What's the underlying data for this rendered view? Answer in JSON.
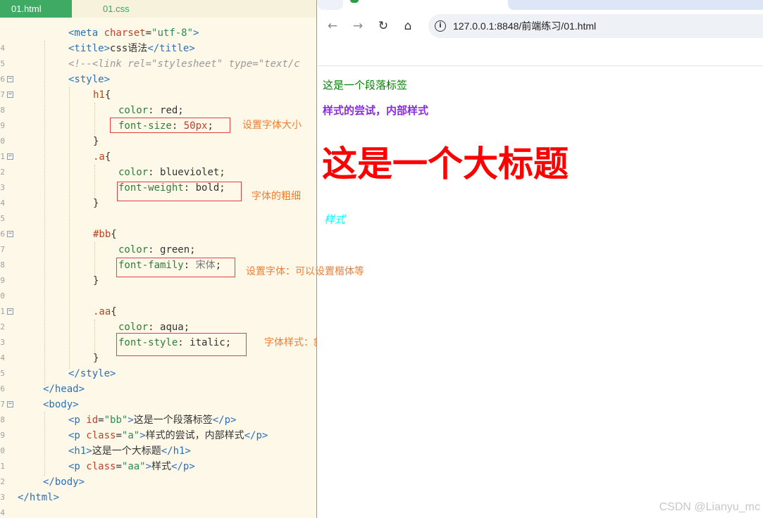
{
  "editor": {
    "tabs": [
      {
        "label": "01.html",
        "active": true
      },
      {
        "label": "01.css",
        "active": false
      }
    ],
    "line_numbers": [
      "4",
      "5",
      "6",
      "7",
      "8",
      "9",
      "0",
      "1",
      "2",
      "3",
      "4",
      "5",
      "6",
      "7",
      "8",
      "9",
      "0",
      "1",
      "2",
      "3",
      "4",
      "5",
      "6",
      "7",
      "8",
      "9",
      "0",
      "1",
      "2",
      "3",
      "4"
    ],
    "fold_glyph": "−",
    "code": {
      "l4": {
        "p1": "<meta ",
        "p2": "charset",
        "p3": "=",
        "p4": "\"utf-8\"",
        "p5": ">"
      },
      "l5": {
        "p1": "<title>",
        "p2": "css语法",
        "p3": "</title>"
      },
      "l6": {
        "p1": "<!--<link rel=\"stylesheet\" type=\"text/c"
      },
      "l7": {
        "p1": "<style>"
      },
      "l8": {
        "p1": "h1",
        "p2": "{"
      },
      "l9": {
        "p1": "color",
        "p2": ": red;"
      },
      "l10": {
        "p1": "font-size",
        "p2": ": ",
        "p3": "50",
        "p4": "px",
        "p5": ";"
      },
      "l11": {
        "p1": "}"
      },
      "l12": {
        "p1": ".a",
        "p2": "{"
      },
      "l13": {
        "p1": "color",
        "p2": ": blueviolet;"
      },
      "l14": {
        "p1": "font-weight",
        "p2": ": bold;"
      },
      "l15": {
        "p1": "}"
      },
      "l17": {
        "p1": "#bb",
        "p2": "{"
      },
      "l18": {
        "p1": "color",
        "p2": ": green;"
      },
      "l19": {
        "p1": "font-family",
        "p2": ": ",
        "p3": "宋体",
        "p4": ";"
      },
      "l20": {
        "p1": "}"
      },
      "l22": {
        "p1": ".aa",
        "p2": "{"
      },
      "l23": {
        "p1": "color",
        "p2": ": aqua;"
      },
      "l24": {
        "p1": "font-style",
        "p2": ": italic;"
      },
      "l25": {
        "p1": "}"
      },
      "l26": {
        "p1": "</style>"
      },
      "l27": {
        "p1": "</head>"
      },
      "l28": {
        "p1": "<body>"
      },
      "l29": {
        "p1": "<p ",
        "p2": "id",
        "p3": "=",
        "p4": "\"bb\"",
        "p5": ">",
        "p6": "这是一个段落标签",
        "p7": "</p>"
      },
      "l30": {
        "p1": "<p ",
        "p2": "class",
        "p3": "=",
        "p4": "\"a\"",
        "p5": ">",
        "p6": "样式的尝试，内部样式",
        "p7": "</p>"
      },
      "l31": {
        "p1": "<h1>",
        "p2": "这是一个大标题",
        "p3": "</h1>"
      },
      "l32": {
        "p1": "<p ",
        "p2": "class",
        "p3": "=",
        "p4": "\"aa\"",
        "p5": ">",
        "p6": "样式",
        "p7": "</p>"
      },
      "l33": {
        "p1": "</body>"
      },
      "l34": {
        "p1": "</html>"
      }
    },
    "annotations": {
      "font_size": "设置字体大小",
      "font_weight": "字体的粗细",
      "font_family": "设置字体：可以设置楷体等",
      "font_style": "字体样式：斜体"
    }
  },
  "browser": {
    "nav": {
      "back": "←",
      "forward": "→",
      "reload": "↻",
      "home": "⌂",
      "info": "i"
    },
    "url": "127.0.0.1:8848/前端练习/01.html",
    "page": {
      "p_bb": "这是一个段落标签",
      "p_a": "样式的尝试，内部样式",
      "h1": "这是一个大标题",
      "p_aa": "样式"
    }
  },
  "watermark": "CSDN @Lianyu_mc"
}
